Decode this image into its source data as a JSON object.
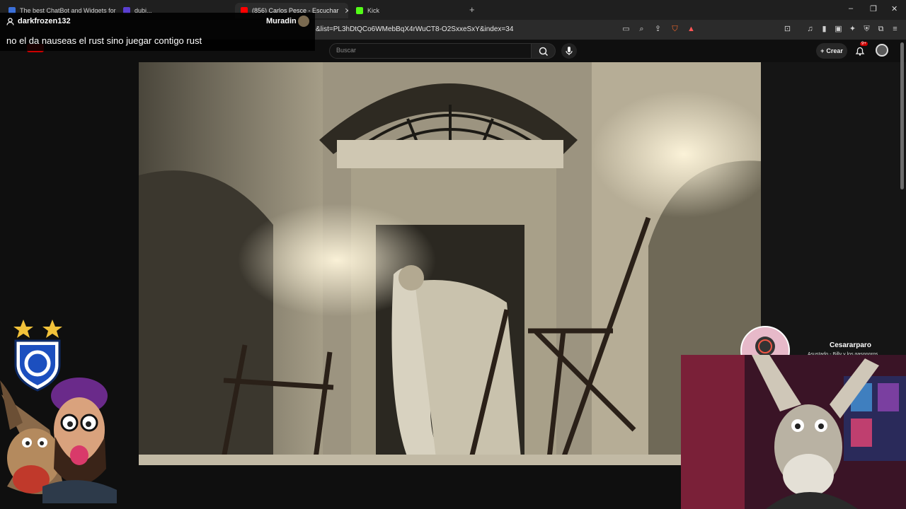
{
  "browser": {
    "tabs": [
      {
        "label": "The best ChatBot and Widgets for Ki",
        "color": "#3b6fd8"
      },
      {
        "label": "dubi...",
        "color": "#5a3fd0"
      },
      {
        "label": "(856) Carlos Pesce - Escuchar",
        "color": "#ff0000"
      },
      {
        "label": "Kick",
        "color": "#53fc18"
      }
    ],
    "new_tab_icon": "plus-icon",
    "url": "&list=PL3hDtQCo6WMebBqX4rWuCT8-O2SxxeSxY&index=34"
  },
  "youtube": {
    "search_placeholder": "Buscar",
    "create_label": "Crear",
    "notifications_badge": "9+"
  },
  "chat_overlay": {
    "username": "darkfrozen132",
    "channel": "Muradin",
    "message": "no el da nauseas el rust sino juegar contigo rust"
  },
  "stream_overlay": {
    "streamer_name": "Cesararparo",
    "subtitle": "Asustado.- Billy y los gasonoros."
  }
}
